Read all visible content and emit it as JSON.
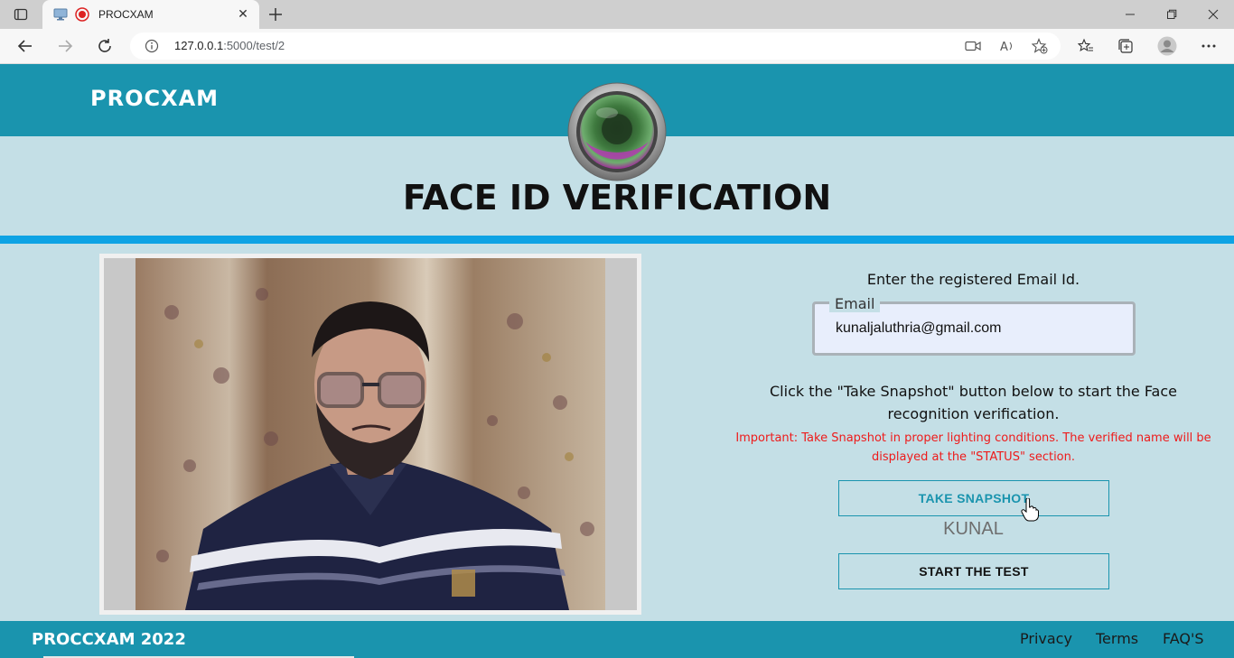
{
  "browser": {
    "tab_title": "PROCXAM",
    "url_host": "127.0.0.1",
    "url_rest": ":5000/test/2"
  },
  "header": {
    "brand": "PROCXAM"
  },
  "main": {
    "title": "FACE ID VERIFICATION",
    "enter_email_text": "Enter the registered Email Id.",
    "email_label": "Email",
    "email_value": "kunaljaluthria@gmail.com",
    "instructions": "Click the \"Take Snapshot\" button below to start the Face recognition verification.",
    "important": "Important: Take Snapshot in proper lighting conditions. The verified name will be displayed at the \"STATUS\" section.",
    "snapshot_button": "TAKE SNAPSHOT",
    "status_name": "KUNAL",
    "start_button": "START THE TEST"
  },
  "footer": {
    "brand": "PROCCXAM 2022",
    "links": [
      "Privacy",
      "Terms",
      "FAQ'S"
    ]
  },
  "colors": {
    "header_bg": "#1a94ae",
    "page_bg": "#c4dfe6",
    "accent_rule": "#0ea3e4",
    "important_text": "#ee1b1b"
  }
}
